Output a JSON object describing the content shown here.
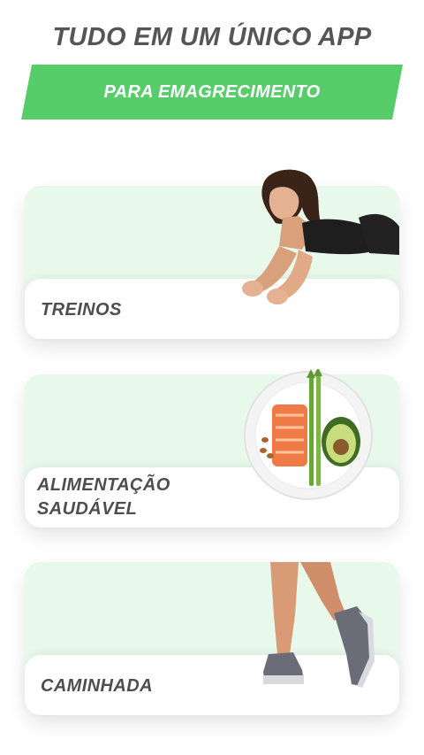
{
  "header": {
    "title": "TUDO EM UM ÚNICO APP",
    "subtitle": "PARA EMAGRECIMENTO"
  },
  "cards": [
    {
      "label_lines": [
        "TREINOS"
      ],
      "illustration": "woman-plank-illustration"
    },
    {
      "label_lines": [
        "ALIMENTAÇÃO",
        "SAUDÁVEL"
      ],
      "illustration": "healthy-plate-illustration"
    },
    {
      "label_lines": [
        "CAMINHADA"
      ],
      "illustration": "walking-legs-illustration"
    }
  ],
  "colors": {
    "accent_green": "#57cd6a",
    "card_tint": "#e8f8ea",
    "text_gray": "#555555"
  }
}
